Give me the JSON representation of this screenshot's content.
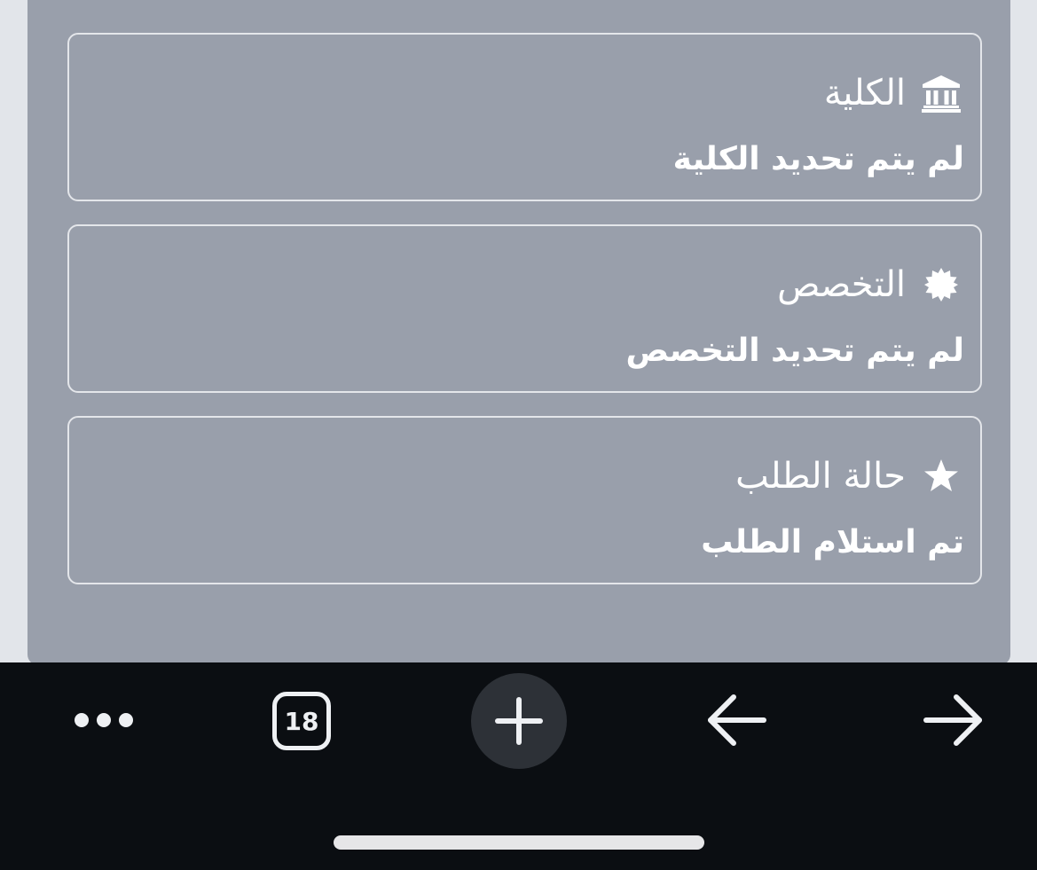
{
  "cards": [
    {
      "label": "الكلية",
      "icon": "university-icon",
      "value": "لم يتم تحديد الكلية"
    },
    {
      "label": "التخصص",
      "icon": "certificate-icon",
      "value": "لم يتم تحديد التخصص"
    },
    {
      "label": "حالة الطلب",
      "icon": "star-icon",
      "value": "تم استلام الطلب"
    }
  ],
  "toolbar": {
    "tab_count": "18",
    "icons": [
      "more-icon",
      "tabs-icon",
      "plus-icon",
      "back-arrow-icon",
      "forward-arrow-icon"
    ]
  },
  "colors": {
    "panel": "#999fab",
    "toolbar": "#0b0e12",
    "new_tab_button": "#2d3137",
    "card_border": "#e4e6ea",
    "text": "#ffffff"
  }
}
